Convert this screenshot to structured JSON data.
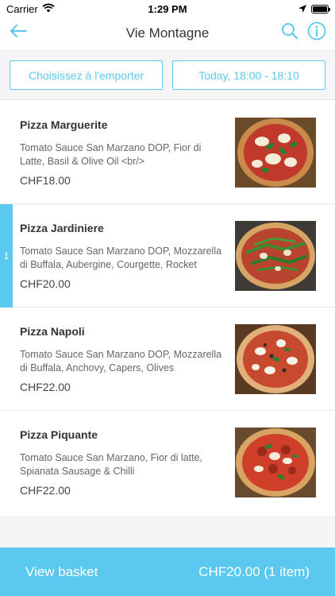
{
  "status_bar": {
    "carrier": "Carrier",
    "time": "1:29 PM"
  },
  "nav": {
    "title": "Vie Montagne"
  },
  "filters": {
    "order_type": "Choisissez à l'emporter",
    "time_slot": "Today, 18:00 - 18:10"
  },
  "menu": {
    "items": [
      {
        "name": "Pizza Marguerite",
        "description": "Tomato Sauce San Marzano DOP, Fior di Latte, Basil & Olive Oil <br/>",
        "price": "CHF18.00"
      },
      {
        "name": "Pizza Jardiniere",
        "description": "Tomato Sauce San Marzano DOP, Mozzarella di Buffala, Aubergine, Courgette, Rocket",
        "price": "CHF20.00",
        "quantity": "1"
      },
      {
        "name": "Pizza Napoli",
        "description": "Tomato Sauce San Marzano DOP, Mozzarella di Buffala, Anchovy, Capers, Olives",
        "price": "CHF22.00"
      },
      {
        "name": "Pizza Piquante",
        "description": "Tomato Sauce San Marzano, Fior di latte, Spianata Sausage & Chilli",
        "price": "CHF22.00"
      }
    ]
  },
  "basket": {
    "label": "View basket",
    "total": "CHF20.00 (1 item)"
  },
  "colors": {
    "accent": "#5bc8ef",
    "text": "#333333",
    "muted_text": "#666666",
    "section_bg": "#f5f5f5"
  },
  "icons": [
    "wifi-icon",
    "location-arrow-icon",
    "battery-icon",
    "back-arrow-icon",
    "search-icon",
    "info-icon"
  ]
}
